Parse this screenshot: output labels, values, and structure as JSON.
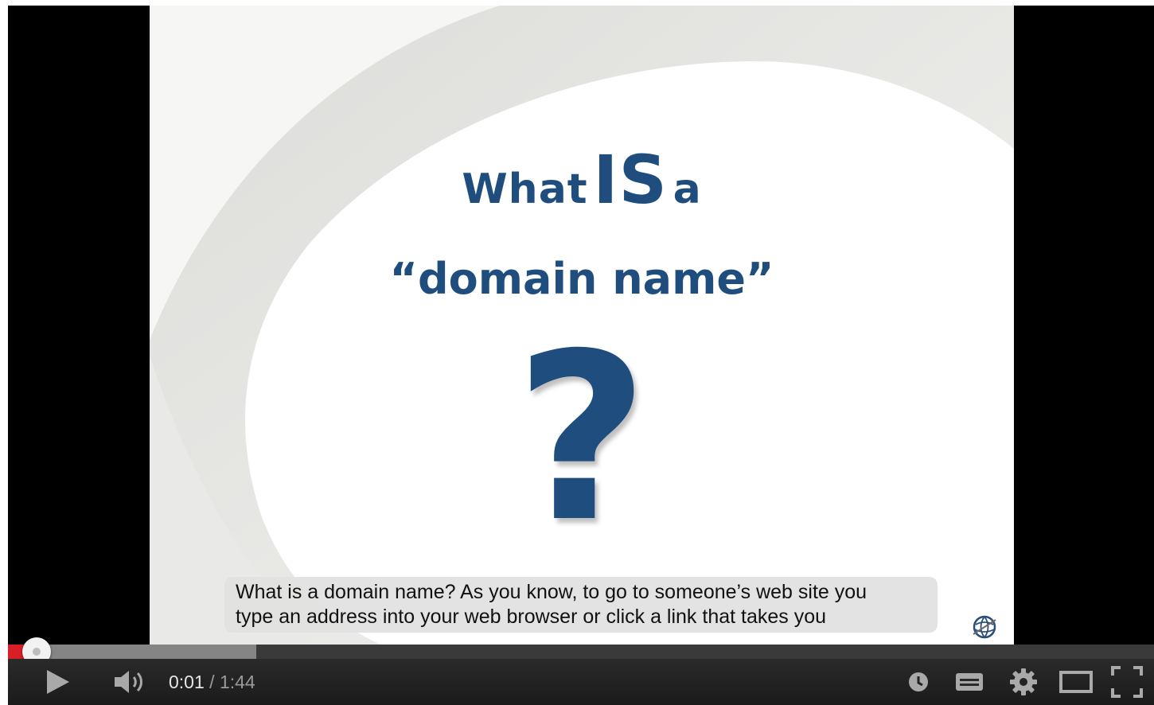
{
  "slide": {
    "title_what": "What",
    "title_is": "IS",
    "title_a": "a",
    "title_line2": "“domain name”",
    "question_mark": "?"
  },
  "caption": {
    "line1": "What is a domain name? As you know, to go to someone’s web site you",
    "line2": "type an address into your web browser or click a link that takes you"
  },
  "player": {
    "current_time": "0:01",
    "separator": " / ",
    "duration": "1:44",
    "played_fraction": 0.025,
    "buffered_fraction": 0.217,
    "accent_color": "#d91f26",
    "title_color": "#1f4e7e"
  },
  "icons": {
    "play": "play-icon",
    "volume": "volume-icon",
    "watch_later": "watch-later-icon",
    "captions": "captions-icon",
    "settings": "gear-icon",
    "theater": "theater-mode-icon",
    "fullscreen": "fullscreen-icon",
    "logo": "globe-logo-icon"
  }
}
